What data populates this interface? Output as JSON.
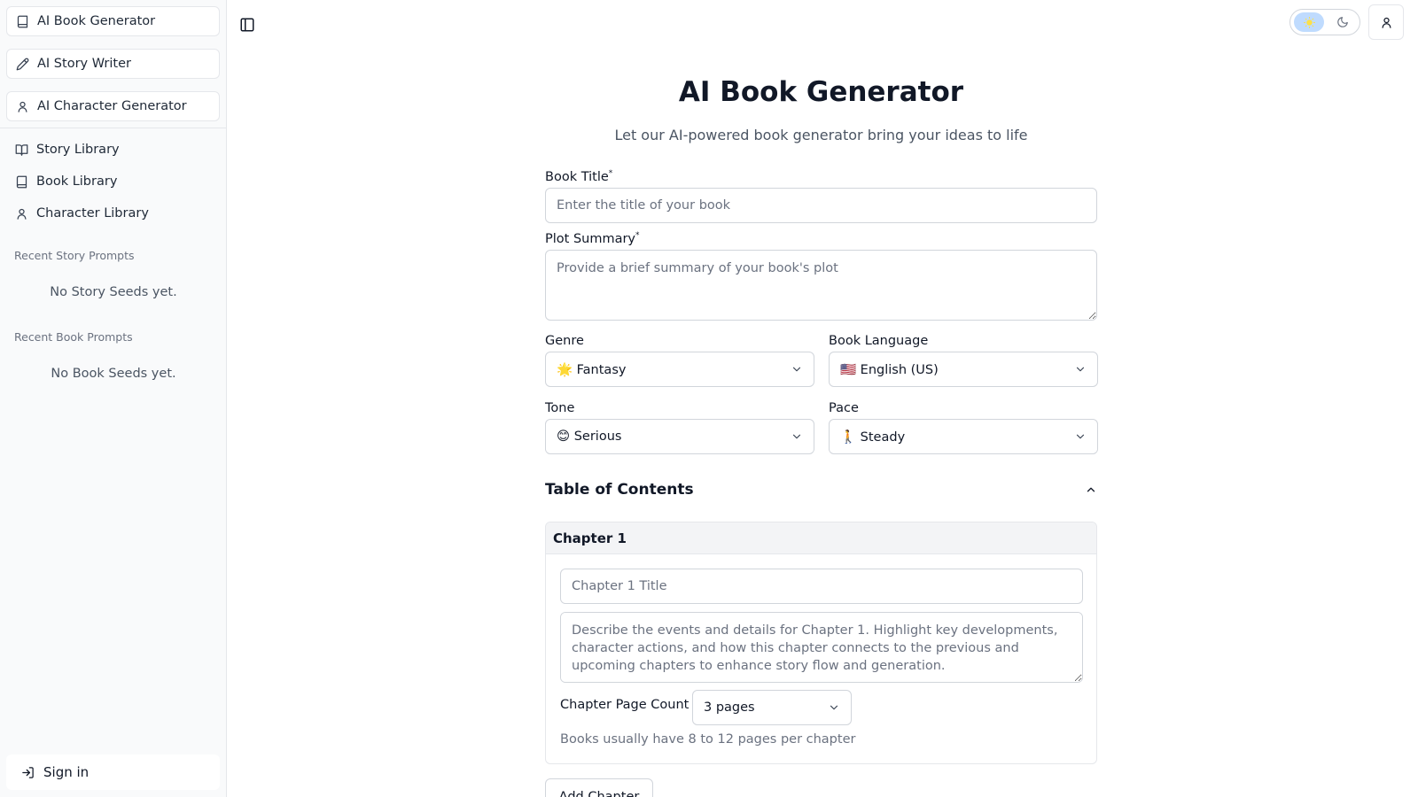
{
  "sidebar": {
    "generators": [
      {
        "label": "AI Book Generator",
        "icon": "book-icon"
      },
      {
        "label": "AI Story Writer",
        "icon": "pencil-icon"
      },
      {
        "label": "AI Character Generator",
        "icon": "user-icon"
      }
    ],
    "nav": [
      {
        "label": "Story Library",
        "icon": "open-book-icon"
      },
      {
        "label": "Book Library",
        "icon": "book-icon"
      },
      {
        "label": "Character Library",
        "icon": "user-icon"
      }
    ],
    "recent_story_label": "Recent Story Prompts",
    "recent_story_empty": "No Story Seeds yet.",
    "recent_book_label": "Recent Book Prompts",
    "recent_book_empty": "No Book Seeds yet.",
    "signin_label": "Sign in"
  },
  "header": {
    "toggle_sidebar_icon": "panel-left-icon",
    "theme_light_icon": "sun-icon",
    "theme_dark_icon": "moon-icon",
    "user_icon": "user-icon"
  },
  "main": {
    "title": "AI Book Generator",
    "subtitle": "Let our AI-powered book generator bring your ideas to life",
    "book_title": {
      "label": "Book Title",
      "required": "*",
      "placeholder": "Enter the title of your book",
      "value": ""
    },
    "plot_summary": {
      "label": "Plot Summary",
      "required": "*",
      "placeholder": "Provide a brief summary of your book's plot",
      "value": ""
    },
    "genre": {
      "label": "Genre",
      "value": "🌟 Fantasy"
    },
    "language": {
      "label": "Book Language",
      "value": "🇺🇸 English (US)"
    },
    "tone": {
      "label": "Tone",
      "value": "😊 Serious"
    },
    "pace": {
      "label": "Pace",
      "value": "🚶 Steady"
    },
    "toc": {
      "title": "Table of Contents",
      "chapters": [
        {
          "heading": "Chapter 1",
          "title_placeholder": "Chapter 1 Title",
          "desc_placeholder": "Describe the events and details for Chapter 1. Highlight key developments, character actions, and how this chapter connects to the previous and upcoming chapters to enhance story flow and generation.",
          "page_count_label": "Chapter Page Count",
          "page_count_value": "3 pages",
          "hint": "Books usually have 8 to 12 pages per chapter"
        }
      ],
      "add_chapter_label": "Add Chapter"
    }
  },
  "colors": {
    "accent_light": "#bfdbfe",
    "border": "#d1d5db",
    "sidebar_bg": "#f9fafb"
  }
}
